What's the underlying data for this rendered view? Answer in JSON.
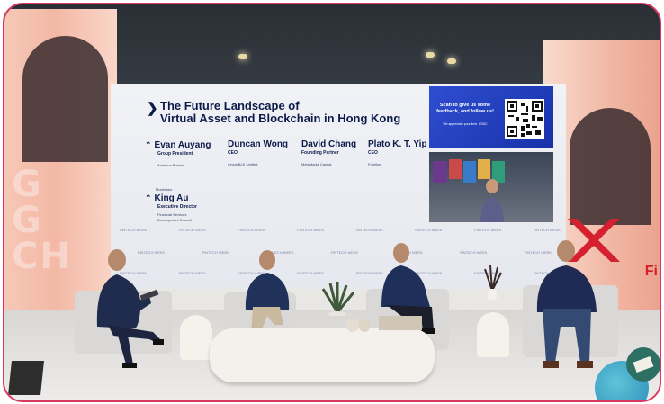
{
  "screen": {
    "title_line1": "The Future Landscape of",
    "title_line2": "Virtual Asset and Blockchain in Hong Kong",
    "speakers": [
      {
        "name": "Evan Auyang",
        "role": "Group President",
        "org": "Animoca Brands"
      },
      {
        "name": "Duncan Wong",
        "role": "CEO",
        "org": "CryptoBLK Limited"
      },
      {
        "name": "David Chang",
        "role": "Founding Partner",
        "org": "MetaMarks Capital"
      },
      {
        "name": "Plato K. T. Yip",
        "role": "CEO",
        "org": "Foreline"
      }
    ],
    "moderator_label": "Moderator",
    "moderator": {
      "name": "King Au",
      "role": "Executive Director",
      "org_line1": "Financial Services",
      "org_line2": "Development Council"
    },
    "qr_text": "Scan to give us some feedback, and follow us!",
    "qr_subtext": "We appreciate your time. FSDC",
    "backdrop_logo": "FINTECH WEEK"
  },
  "venue": {
    "neon_text": "G\nG\nCH",
    "right_wall_text": "Fi"
  },
  "colors": {
    "frame_border": "#d9385f",
    "screen_navy": "#0d1b4a",
    "qr_blue": "#1f3cc0",
    "stage_pink": "#f3b8a6",
    "logo_red": "#d4202f"
  }
}
